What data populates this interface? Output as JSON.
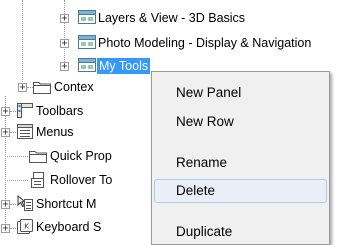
{
  "tree": {
    "items": [
      {
        "label": "Layers & View - 3D Basics",
        "icon": "panel-icon"
      },
      {
        "label": "Photo Modeling - Display & Navigation",
        "icon": "panel-icon"
      },
      {
        "label": "My Tools",
        "icon": "panel-icon",
        "selected": true
      },
      {
        "label": "Contex",
        "icon": "folder-icon"
      },
      {
        "label": "Toolbars",
        "icon": "toolbar-icon"
      },
      {
        "label": "Menus",
        "icon": "menu-icon"
      },
      {
        "label": "Quick Prop",
        "icon": "folder-icon"
      },
      {
        "label": "Rollover To",
        "icon": "rollover-icon"
      },
      {
        "label": "Shortcut M",
        "icon": "shortcut-menu-icon"
      },
      {
        "label": "Keyboard S",
        "icon": "keyboard-icon"
      }
    ]
  },
  "context_menu": {
    "items": [
      {
        "label": "New Panel"
      },
      {
        "label": "New Row"
      },
      {
        "label": "Rename"
      },
      {
        "label": "Delete",
        "hovered": true
      },
      {
        "label": "Duplicate"
      }
    ]
  },
  "colors": {
    "selection": "#3399ff",
    "menu_background": "#f0f0f0",
    "menu_hover": "#e8eff7"
  }
}
